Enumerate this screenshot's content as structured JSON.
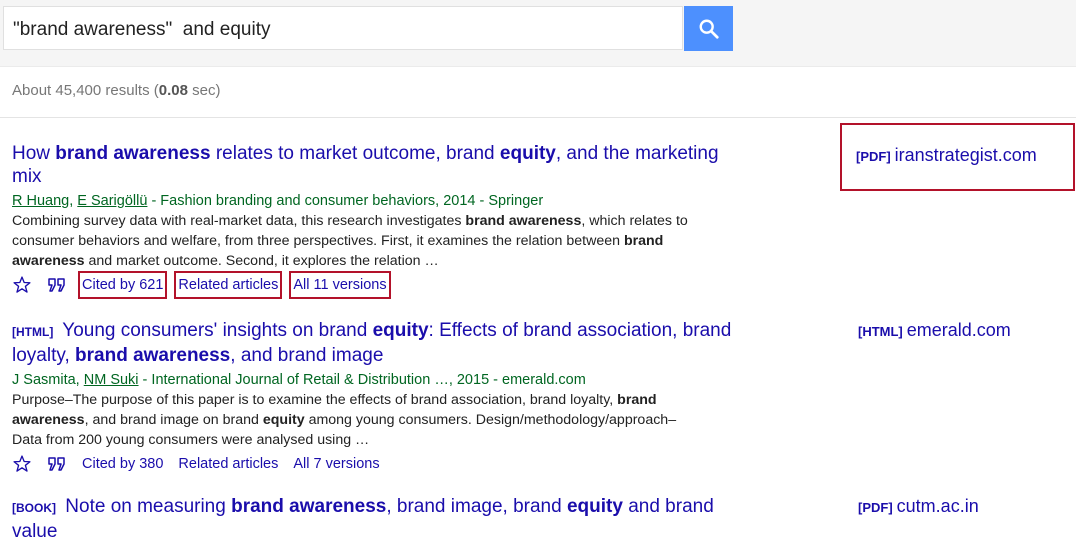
{
  "search": {
    "query": "\"brand awareness\"  and equity",
    "button_icon": "search-icon"
  },
  "stats": {
    "prefix": "About 45,400 results (",
    "time": "0.08",
    "suffix": " sec)"
  },
  "results": [
    {
      "type": "",
      "title_parts": [
        "How ",
        "brand awareness",
        " relates to market outcome, brand ",
        "equity",
        ", and the marketing mix"
      ],
      "authors": [
        "R Huang",
        "E Sarigöllü"
      ],
      "source": " - Fashion branding and consumer behaviors, 2014 - Springer",
      "snippet_parts": [
        "Combining survey data with real-market data, this research investigates ",
        "brand awareness",
        ", which relates to consumer behaviors and welfare, from three perspectives. First, it examines the relation between ",
        "brand awareness",
        " and market outcome. Second, it explores the relation …"
      ],
      "cited_by": "Cited by 621",
      "related": "Related articles",
      "versions": "All 11 versions",
      "side_type": "[PDF]",
      "side_domain": "iranstrategist.com"
    },
    {
      "type": "[HTML]",
      "title_parts": [
        " Young consumers' insights on brand ",
        "equity",
        ": Effects of brand association, brand loyalty, ",
        "brand awareness",
        ", and brand image"
      ],
      "authors": [
        "J Sasmita",
        "NM Suki"
      ],
      "source": " - International Journal of Retail & Distribution …, 2015 - emerald.com",
      "snippet_parts": [
        "Purpose–The purpose of this paper is to examine the effects of brand association, brand loyalty, ",
        "brand awareness",
        ", and brand image on brand ",
        "equity",
        " among young consumers. Design/methodology/approach–Data from 200 young consumers were analysed using …"
      ],
      "cited_by": "Cited by 380",
      "related": "Related articles",
      "versions": "All 7 versions",
      "side_type": "[HTML]",
      "side_domain": "emerald.com"
    },
    {
      "type": "[BOOK]",
      "title_parts": [
        " Note on measuring ",
        "brand awareness",
        ", brand image, brand ",
        "equity",
        " and brand value"
      ],
      "side_type": "[PDF]",
      "side_domain": "cutm.ac.in"
    }
  ]
}
